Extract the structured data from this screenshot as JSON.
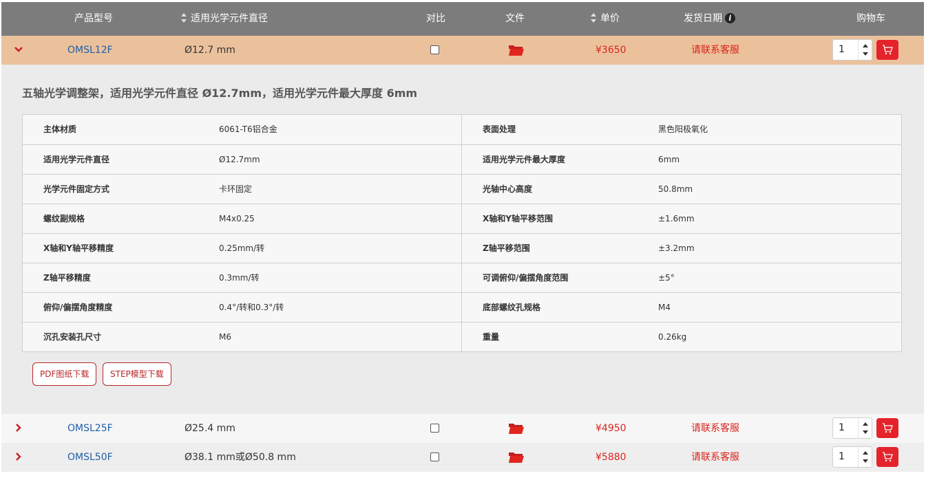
{
  "header": {
    "model": "产品型号",
    "diameter": "适用光学元件直径",
    "compare": "对比",
    "file": "文件",
    "price": "单价",
    "ship_date": "发货日期",
    "cart": "购物车"
  },
  "rows": [
    {
      "model": "OMSL12F",
      "diameter": "Ø12.7 mm",
      "price": "¥3650",
      "ship": "请联系客服",
      "qty": "1"
    },
    {
      "model": "OMSL25F",
      "diameter": "Ø25.4 mm",
      "price": "¥4950",
      "ship": "请联系客服",
      "qty": "1"
    },
    {
      "model": "OMSL50F",
      "diameter": "Ø38.1 mm或Ø50.8 mm",
      "price": "¥5880",
      "ship": "请联系客服",
      "qty": "1"
    }
  ],
  "detail": {
    "title": "五轴光学调整架，适用光学元件直径 Ø12.7mm，适用光学元件最大厚度 6mm",
    "specs": [
      {
        "k1": "主体材质",
        "v1": "6061-T6铝合金",
        "k2": "表面处理",
        "v2": "黑色阳极氧化"
      },
      {
        "k1": "适用光学元件直径",
        "v1": "Ø12.7mm",
        "k2": "适用光学元件最大厚度",
        "v2": "6mm"
      },
      {
        "k1": "光学元件固定方式",
        "v1": "卡环固定",
        "k2": "光轴中心高度",
        "v2": "50.8mm"
      },
      {
        "k1": "螺纹副规格",
        "v1": "M4x0.25",
        "k2": "X轴和Y轴平移范围",
        "v2": "±1.6mm"
      },
      {
        "k1": "X轴和Y轴平移精度",
        "v1": "0.25mm/转",
        "k2": "Z轴平移范围",
        "v2": "±3.2mm"
      },
      {
        "k1": "Z轴平移精度",
        "v1": "0.3mm/转",
        "k2": "可调俯仰/偏摆角度范围",
        "v2": "±5°"
      },
      {
        "k1": "俯仰/偏摆角度精度",
        "v1": "0.4°/转和0.3°/转",
        "k2": "底部螺纹孔规格",
        "v2": "M4"
      },
      {
        "k1": "沉孔安装孔尺寸",
        "v1": "M6",
        "k2": "重量",
        "v2": "0.26kg"
      }
    ],
    "pdf_button": "PDF图纸下载",
    "step_button": "STEP模型下载"
  },
  "icons": {
    "expand": "chevron-down-icon",
    "collapse": "chevron-right-icon",
    "file": "folder-icon",
    "cart": "cart-icon",
    "sort": "sort-icon",
    "info": "info-icon"
  },
  "colors": {
    "header_bg": "#7c7c7c",
    "expanded_row_bg": "#ebc19c",
    "accent_red": "#d9241c",
    "link_blue": "#1f5fa9",
    "cart_button": "#e5232b"
  }
}
